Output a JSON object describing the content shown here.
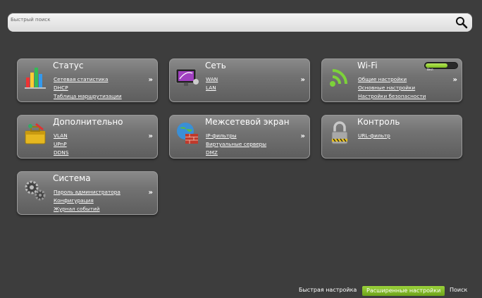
{
  "search": {
    "placeholder": "Быстрый поиск"
  },
  "tiles": [
    {
      "title": "Статус",
      "icon": "bar-chart-icon",
      "links": [
        "Сетевая статистика",
        "DHCP",
        "Таблица маршрутизации"
      ]
    },
    {
      "title": "Сеть",
      "icon": "network-monitor-icon",
      "links": [
        "WAN",
        "LAN"
      ]
    },
    {
      "title": "Wi-Fi",
      "icon": "wifi-icon",
      "links": [
        "Общие настройки",
        "Основные настройки",
        "Настройки безопасности"
      ],
      "toggle_label": "Вкл",
      "toggle_level": 0.7,
      "toggle_color": "#8ccc2a"
    },
    {
      "title": "Дополнительно",
      "icon": "toolbox-icon",
      "links": [
        "VLAN",
        "UPnP",
        "DDNS"
      ]
    },
    {
      "title": "Межсетевой экран",
      "icon": "firewall-icon",
      "links": [
        "IP-фильтры",
        "Виртуальные серверы",
        "DMZ"
      ]
    },
    {
      "title": "Контроль",
      "icon": "padlock-icon",
      "links": [
        "URL-фильтр"
      ]
    },
    {
      "title": "Система",
      "icon": "gears-icon",
      "links": [
        "Пароль администратора",
        "Конфигурация",
        "Журнал событий"
      ]
    }
  ],
  "arrow_glyph": "»",
  "bottom_nav": {
    "quick_setup": "Быстрая настройка",
    "advanced_settings": "Расширенные настройки",
    "search": "Поиск"
  },
  "colors": {
    "background": "#3d3d3d",
    "accent_green": "#8ccc2a"
  }
}
